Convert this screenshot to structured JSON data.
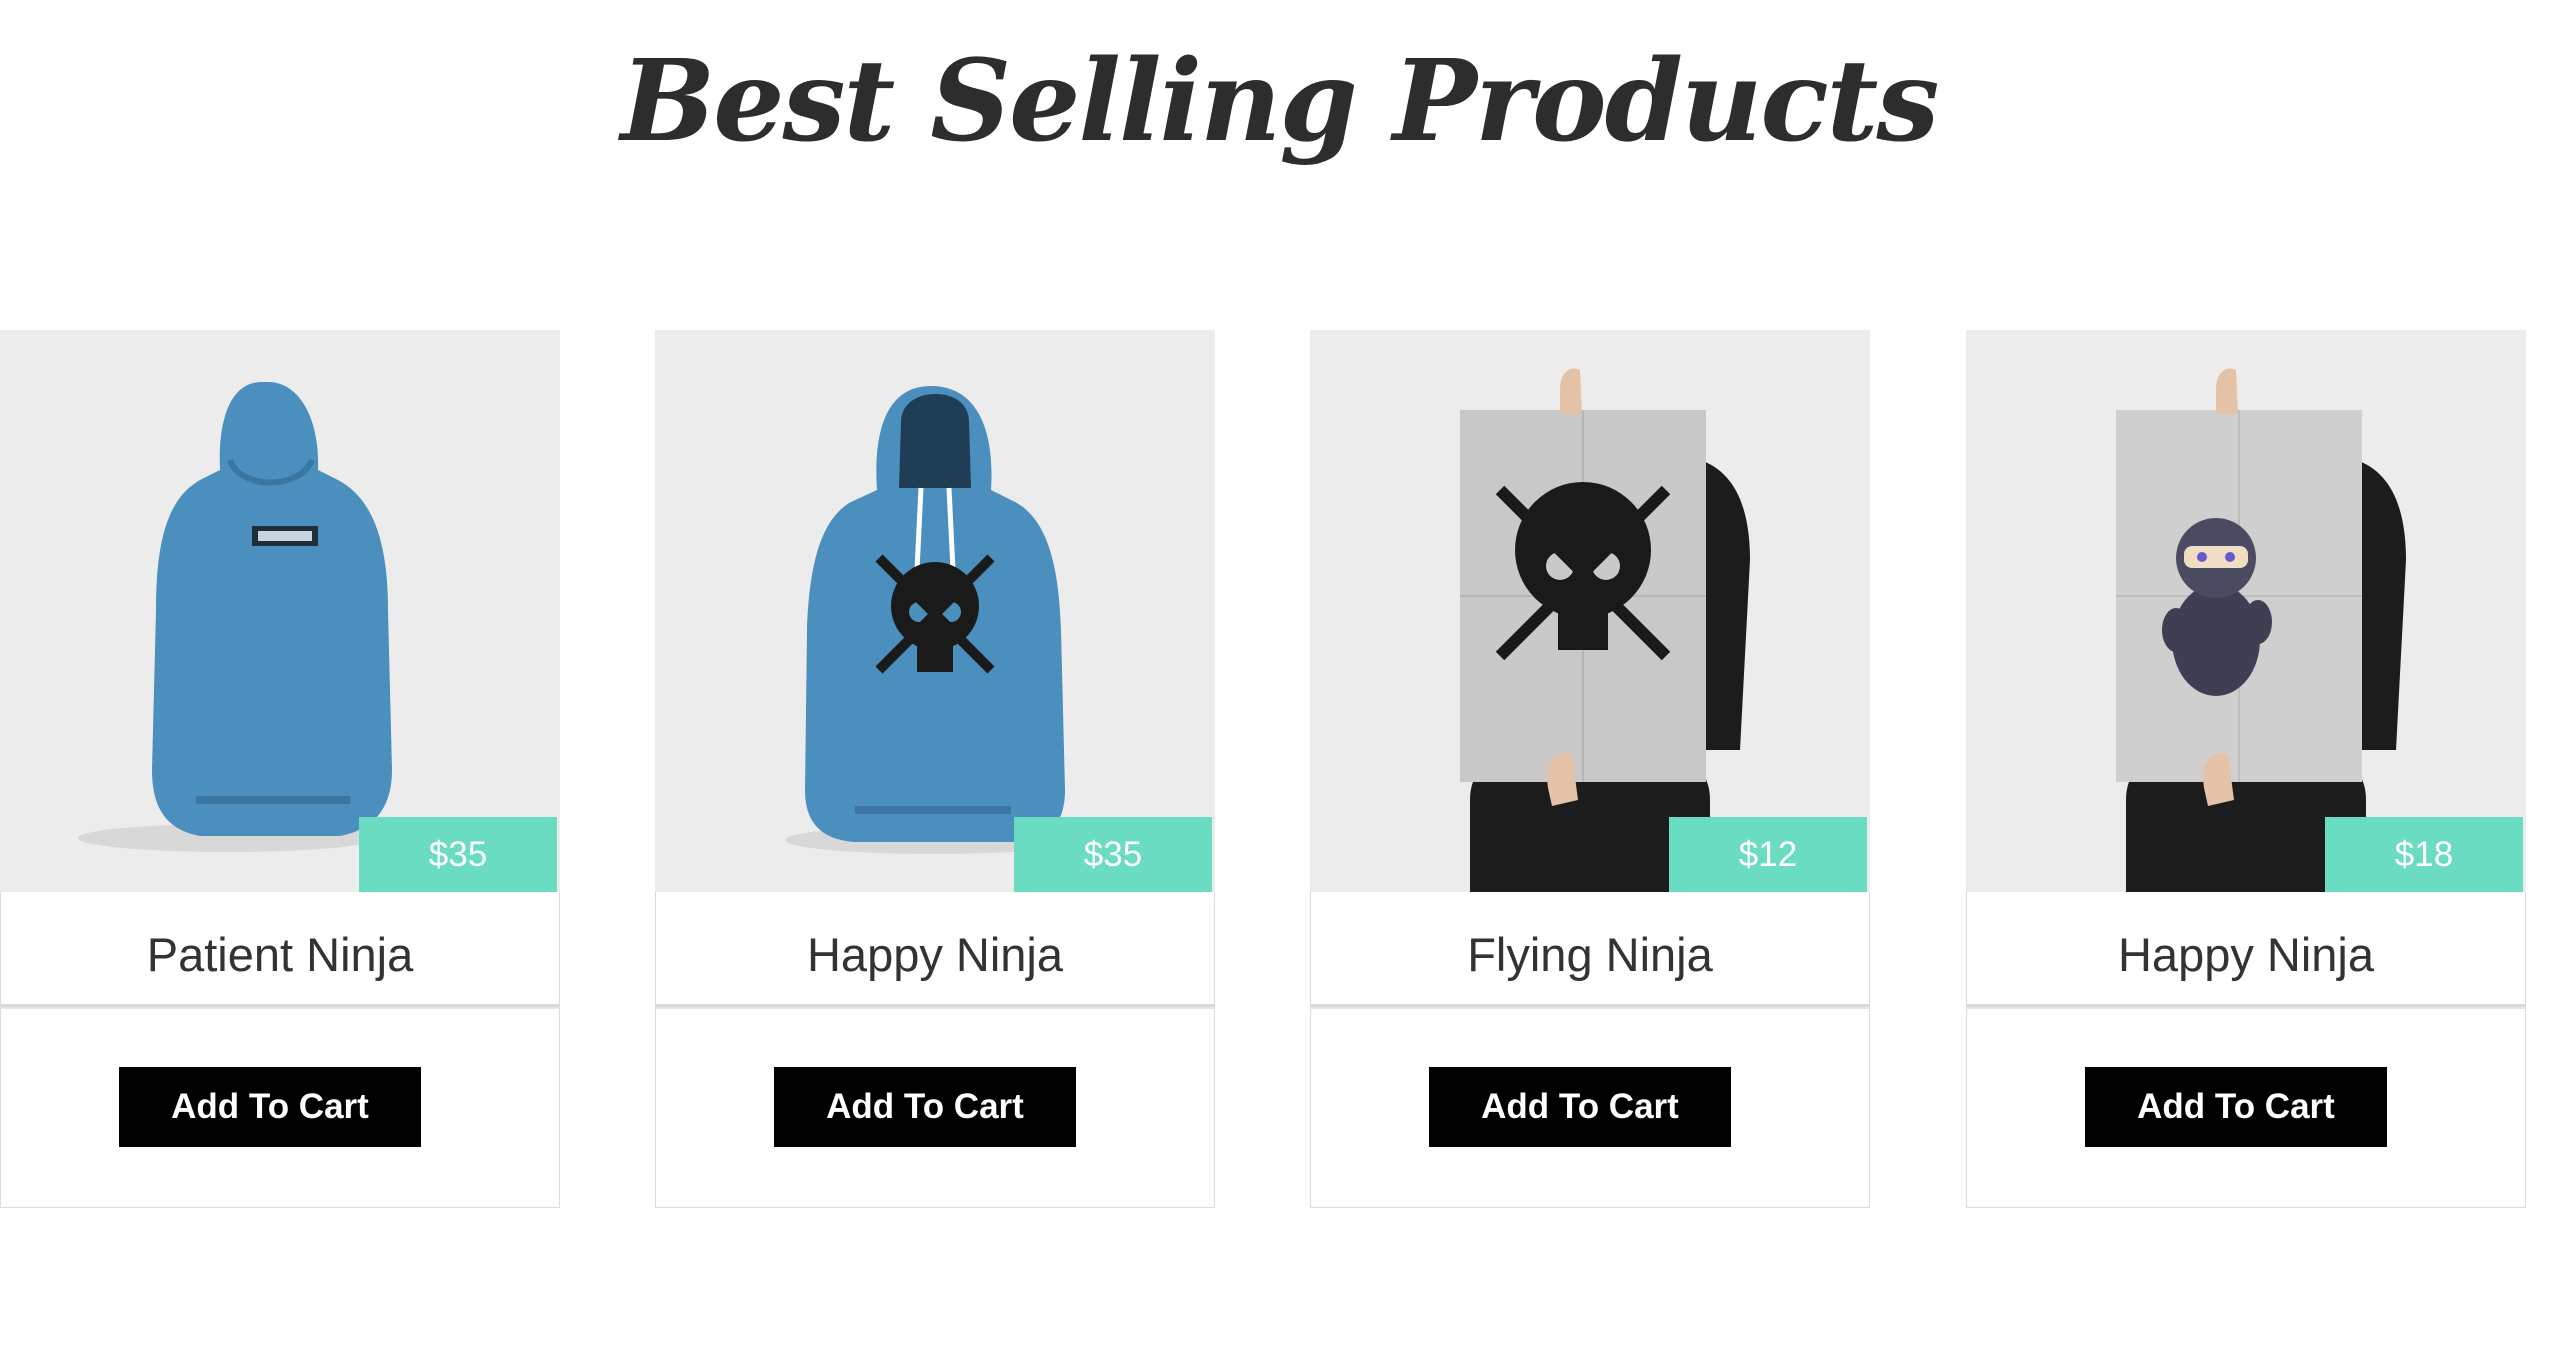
{
  "page": {
    "title": "Best Selling Products"
  },
  "colors": {
    "price_tag": "#69dcc2",
    "button": "#000000",
    "image_background": "#ececec"
  },
  "products": [
    {
      "name": "Patient Ninja",
      "price": "$35",
      "button_label": "Add To Cart",
      "image": "blue-hoodie-back"
    },
    {
      "name": "Happy Ninja",
      "price": "$35",
      "button_label": "Add To Cart",
      "image": "blue-hoodie-front-skull"
    },
    {
      "name": "Flying Ninja",
      "price": "$12",
      "button_label": "Add To Cart",
      "image": "poster-skull"
    },
    {
      "name": "Happy Ninja",
      "price": "$18",
      "button_label": "Add To Cart",
      "image": "poster-ninja"
    }
  ]
}
